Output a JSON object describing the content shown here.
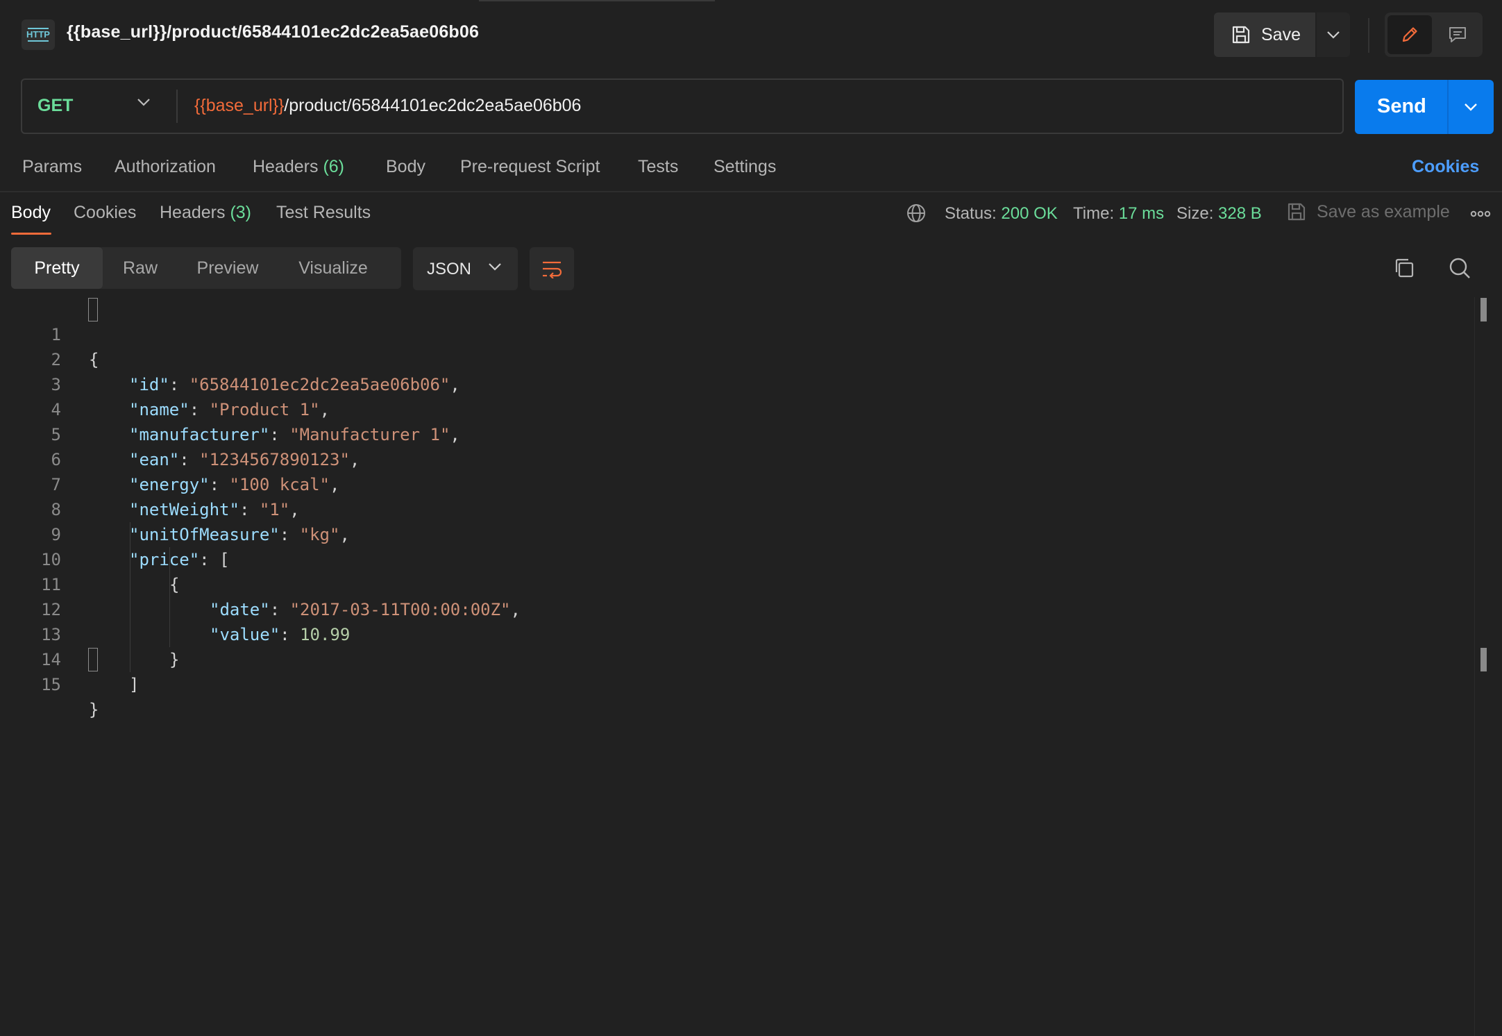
{
  "header": {
    "title": "{{base_url}}/product/65844101ec2dc2ea5ae06b06",
    "save_label": "Save"
  },
  "request": {
    "method": "GET",
    "url_variable": "{{base_url}}",
    "url_path": "/product/65844101ec2dc2ea5ae06b06",
    "send_label": "Send"
  },
  "request_tabs": {
    "params": "Params",
    "authorization": "Authorization",
    "headers": "Headers",
    "headers_count": "(6)",
    "body": "Body",
    "pre_request": "Pre-request Script",
    "tests": "Tests",
    "settings": "Settings",
    "cookies": "Cookies"
  },
  "response_tabs": {
    "body": "Body",
    "cookies": "Cookies",
    "headers": "Headers",
    "headers_count": "(3)",
    "test_results": "Test Results"
  },
  "status": {
    "status_label": "Status:",
    "status_value": "200 OK",
    "time_label": "Time:",
    "time_value": "17 ms",
    "size_label": "Size:",
    "size_value": "328 B",
    "save_example": "Save as example"
  },
  "view_modes": {
    "pretty": "Pretty",
    "raw": "Raw",
    "preview": "Preview",
    "visualize": "Visualize",
    "format": "JSON"
  },
  "code": {
    "line_numbers": [
      "1",
      "2",
      "3",
      "4",
      "5",
      "6",
      "7",
      "8",
      "9",
      "10",
      "11",
      "12",
      "13",
      "14",
      "15"
    ],
    "open_brace": "{",
    "close_brace": "}",
    "k_id": "\"id\"",
    "v_id": "\"65844101ec2dc2ea5ae06b06\"",
    "k_name": "\"name\"",
    "v_name": "\"Product 1\"",
    "k_manufacturer": "\"manufacturer\"",
    "v_manufacturer": "\"Manufacturer 1\"",
    "k_ean": "\"ean\"",
    "v_ean": "\"1234567890123\"",
    "k_energy": "\"energy\"",
    "v_energy": "\"100 kcal\"",
    "k_netWeight": "\"netWeight\"",
    "v_netWeight": "\"1\"",
    "k_unitOfMeasure": "\"unitOfMeasure\"",
    "v_unitOfMeasure": "\"kg\"",
    "k_price": "\"price\"",
    "open_bracket": "[",
    "close_bracket": "]",
    "k_date": "\"date\"",
    "v_date": "\"2017-03-11T00:00:00Z\"",
    "k_value": "\"value\"",
    "v_value": "10.99",
    "colon": ": ",
    "comma": ","
  },
  "colors": {
    "accent_orange": "#f26b3a",
    "success_green": "#6bdd9a",
    "send_blue": "#097bed",
    "link_blue": "#4d9eff"
  },
  "icons": [
    "http-icon",
    "save-icon",
    "chevron-down-icon",
    "pencil-icon",
    "comment-icon",
    "globe-icon",
    "save-example-icon",
    "more-icon",
    "wrap-lines-icon",
    "copy-icon",
    "search-icon"
  ]
}
